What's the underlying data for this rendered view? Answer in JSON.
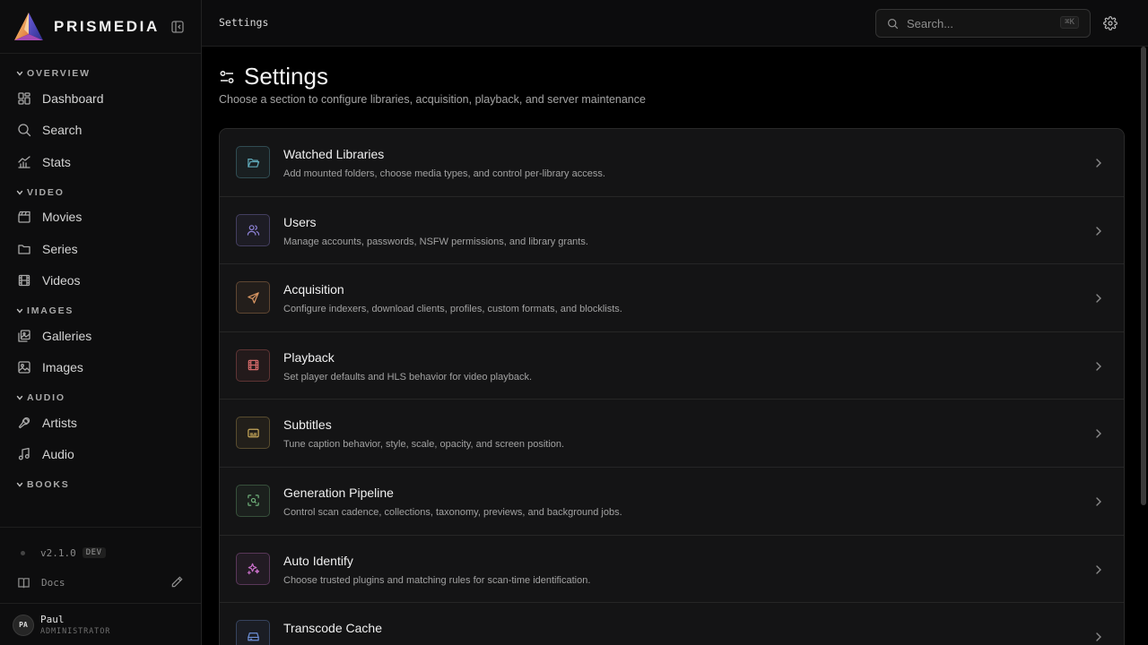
{
  "brand": {
    "name": "PRISMEDIA"
  },
  "nav": {
    "sections": [
      {
        "title": "OVERVIEW",
        "items": [
          {
            "label": "Dashboard",
            "icon": "dashboard-icon"
          },
          {
            "label": "Search",
            "icon": "search-icon"
          },
          {
            "label": "Stats",
            "icon": "stats-icon"
          }
        ]
      },
      {
        "title": "VIDEO",
        "items": [
          {
            "label": "Movies",
            "icon": "clapper-icon"
          },
          {
            "label": "Series",
            "icon": "folder-icon"
          },
          {
            "label": "Videos",
            "icon": "film-icon"
          }
        ]
      },
      {
        "title": "IMAGES",
        "items": [
          {
            "label": "Galleries",
            "icon": "gallery-icon"
          },
          {
            "label": "Images",
            "icon": "image-icon"
          }
        ]
      },
      {
        "title": "AUDIO",
        "items": [
          {
            "label": "Artists",
            "icon": "mic-icon"
          },
          {
            "label": "Audio",
            "icon": "music-icon"
          }
        ]
      },
      {
        "title": "BOOKS",
        "items": []
      }
    ]
  },
  "footer": {
    "version": "v2.1.0",
    "version_tag": "DEV",
    "docs_label": "Docs",
    "user": {
      "initials": "PA",
      "name": "Paul",
      "role": "ADMINISTRATOR"
    }
  },
  "topbar": {
    "breadcrumb": "Settings",
    "search_placeholder": "Search...",
    "search_shortcut": "⌘K"
  },
  "page": {
    "title": "Settings",
    "subtitle": "Choose a section to configure libraries, acquisition, playback, and server maintenance"
  },
  "settings": [
    {
      "title": "Watched Libraries",
      "desc": "Add mounted folders, choose media types, and control per-library access.",
      "icon": "folder-open-icon",
      "color": "#5fa8b8"
    },
    {
      "title": "Users",
      "desc": "Manage accounts, passwords, NSFW permissions, and library grants.",
      "icon": "users-icon",
      "color": "#8f83d8"
    },
    {
      "title": "Acquisition",
      "desc": "Configure indexers, download clients, profiles, custom formats, and blocklists.",
      "icon": "send-icon",
      "color": "#d89663"
    },
    {
      "title": "Playback",
      "desc": "Set player defaults and HLS behavior for video playback.",
      "icon": "film-icon",
      "color": "#d46a6a"
    },
    {
      "title": "Subtitles",
      "desc": "Tune caption behavior, style, scale, opacity, and screen position.",
      "icon": "captions-icon",
      "color": "#c7a85a"
    },
    {
      "title": "Generation Pipeline",
      "desc": "Control scan cadence, collections, taxonomy, previews, and background jobs.",
      "icon": "scan-icon",
      "color": "#6fb07a"
    },
    {
      "title": "Auto Identify",
      "desc": "Choose trusted plugins and matching rules for scan-time identification.",
      "icon": "sparkles-icon",
      "color": "#c86fc8"
    },
    {
      "title": "Transcode Cache",
      "desc": "",
      "icon": "drive-icon",
      "color": "#6d8fd6"
    }
  ]
}
